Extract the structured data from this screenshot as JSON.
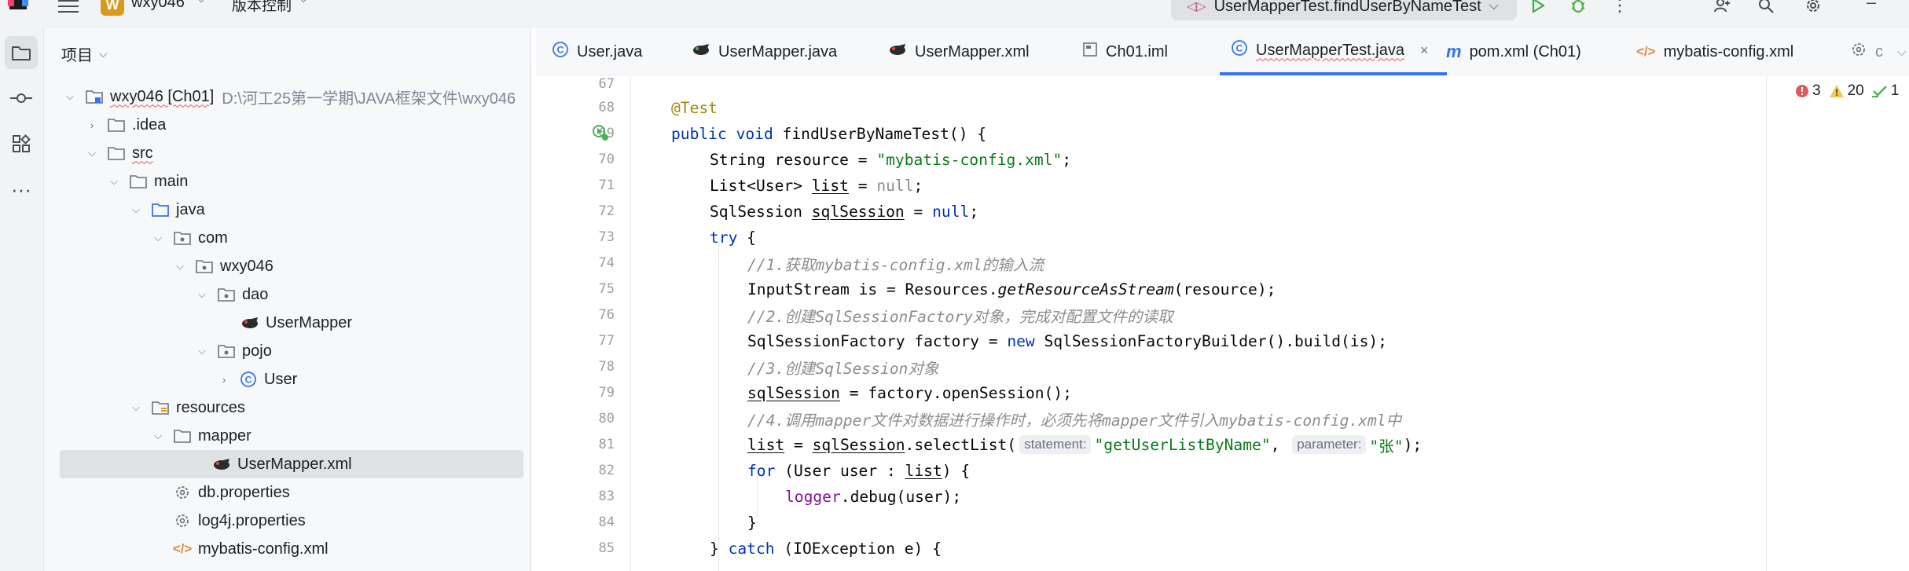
{
  "titlebar": {
    "project_badge": "W",
    "project_name": "wxy046",
    "vcs_label": "版本控制",
    "run_config": "UserMapperTest.findUserByNameTest",
    "colors": {
      "badge": "#d99a1c",
      "run": "#4caf50",
      "debug": "#4caf50"
    }
  },
  "toolstrip": {
    "items": [
      {
        "icon": "folder-icon",
        "active": true
      },
      {
        "icon": "commit-icon",
        "active": false
      },
      {
        "icon": "structure-icon",
        "active": false
      },
      {
        "icon": "more-icon",
        "active": false
      }
    ]
  },
  "project_panel": {
    "title": "项目",
    "tree": [
      {
        "label": "wxy046 [Ch01]",
        "path": "D:\\河工25第一学期\\JAVA框架文件\\wxy046"
      },
      {
        "label": ".idea"
      },
      {
        "label": "src"
      },
      {
        "label": "main"
      },
      {
        "label": "java"
      },
      {
        "label": "com"
      },
      {
        "label": "wxy046"
      },
      {
        "label": "dao"
      },
      {
        "label": "UserMapper"
      },
      {
        "label": "pojo"
      },
      {
        "label": "User"
      },
      {
        "label": "resources"
      },
      {
        "label": "mapper"
      },
      {
        "label": "UserMapper.xml"
      },
      {
        "label": "db.properties"
      },
      {
        "label": "log4j.properties"
      },
      {
        "label": "mybatis-config.xml"
      }
    ]
  },
  "tabs": [
    {
      "label": "User.java",
      "icon": "class-icon"
    },
    {
      "label": "UserMapper.java",
      "icon": "mybatis-icon"
    },
    {
      "label": "UserMapper.xml",
      "icon": "mybatis-icon"
    },
    {
      "label": "Ch01.iml",
      "icon": "module-file-icon"
    },
    {
      "label": "UserMapperTest.java",
      "icon": "class-icon",
      "active": true,
      "close": "×"
    },
    {
      "label": "pom.xml (Ch01)",
      "icon": "maven-icon"
    },
    {
      "label": "mybatis-config.xml",
      "icon": "xml-icon"
    },
    {
      "label": "c",
      "icon": "settings-file-icon"
    }
  ],
  "editor": {
    "line_numbers": [
      "67",
      "68",
      "69",
      "70",
      "71",
      "72",
      "73",
      "74",
      "75",
      "76",
      "77",
      "78",
      "79",
      "80",
      "81",
      "82",
      "83",
      "84",
      "85"
    ],
    "inspections": {
      "errors": "3",
      "warnings": "20",
      "weak_warnings": "1"
    },
    "hints": {
      "statement": "statement:",
      "parameter": "parameter:"
    },
    "code": {
      "l68": "@Test",
      "l69_kw": "public void",
      "l69_rest": " findUserByNameTest() {",
      "l70_a": "String resource = ",
      "l70_str": "\"mybatis-config.xml\"",
      "l70_b": ";",
      "l71_a": "List<User> ",
      "l71_var": "list",
      "l71_b": " = ",
      "l71_null": "null",
      "l71_c": ";",
      "l72_a": "SqlSession ",
      "l72_var": "sqlSession",
      "l72_b": " = ",
      "l72_null": "null",
      "l72_c": ";",
      "l73_kw": "try",
      "l73_b": " {",
      "l74": "//1.获取mybatis-config.xml的输入流",
      "l75_a": "InputStream is = Resources.",
      "l75_it": "getResourceAsStream",
      "l75_b": "(resource);",
      "l76": "//2.创建SqlSessionFactory对象，完成对配置文件的读取",
      "l77_a": "SqlSessionFactory factory = ",
      "l77_kw": "new",
      "l77_b": " SqlSessionFactoryBuilder().build(is);",
      "l78": "//3.创建SqlSession对象",
      "l79_var": "sqlSession",
      "l79_b": " = factory.openSession();",
      "l80": "//4.调用mapper文件对数据进行操作时，必须先将mapper文件引入mybatis-config.xml中",
      "l81_var1": "list",
      "l81_b": " = ",
      "l81_var2": "sqlSession",
      "l81_c": ".selectList(",
      "l81_str1": "\"getUserListByName\"",
      "l81_d": ", ",
      "l81_str2": "\"张\"",
      "l81_e": ");",
      "l82_kw": "for",
      "l82_a": " (User user : ",
      "l82_var": "list",
      "l82_b": ") {",
      "l83_fld": "logger",
      "l83_b": ".debug(user);",
      "l84": "}",
      "l85_a": "} ",
      "l85_kw": "catch",
      "l85_b": " (IOException e) {"
    }
  }
}
